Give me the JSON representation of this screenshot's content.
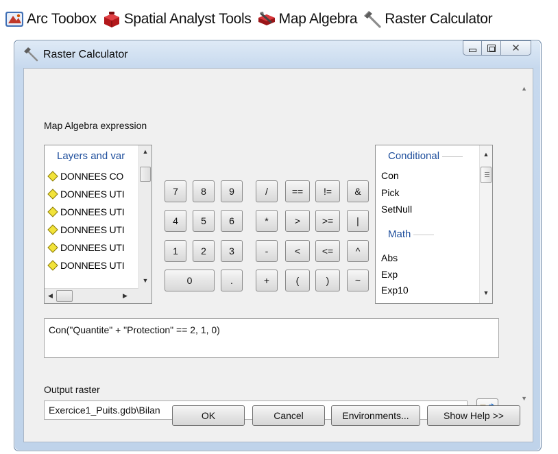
{
  "breadcrumb": [
    {
      "label": "Arc Toobox",
      "icon": "arc-toolbox-icon"
    },
    {
      "label": "Spatial Analyst Tools",
      "icon": "red-toolbox-icon"
    },
    {
      "label": "Map Algebra",
      "icon": "toolset-icon"
    },
    {
      "label": "Raster Calculator",
      "icon": "hammer-icon"
    }
  ],
  "window": {
    "title": "Raster Calculator",
    "controls": {
      "minimize": "minimize",
      "maximize": "maximize",
      "close": "close"
    }
  },
  "expression_label": "Map Algebra expression",
  "layers_panel": {
    "header": "Layers and var",
    "items": [
      "DONNEES CO",
      "DONNEES UTI",
      "DONNEES UTI",
      "DONNEES UTI",
      "DONNEES UTI",
      "DONNEES UTI"
    ]
  },
  "keypad": {
    "rows": [
      [
        "7",
        "8",
        "9",
        "/",
        "==",
        "!=",
        "&"
      ],
      [
        "4",
        "5",
        "6",
        "*",
        ">",
        ">=",
        "|"
      ],
      [
        "1",
        "2",
        "3",
        "-",
        "<",
        "<=",
        "^"
      ],
      [
        "0",
        ".",
        "+",
        "(",
        ")",
        "~"
      ]
    ]
  },
  "functions_panel": {
    "groups": [
      {
        "header": "Conditional",
        "items": [
          "Con",
          "Pick",
          "SetNull"
        ]
      },
      {
        "header": "Math",
        "items": [
          "Abs",
          "Exp",
          "Exp10"
        ]
      }
    ]
  },
  "expression": "Con(\"Quantite\" + \"Protection\" == 2, 1, 0)",
  "output_label": "Output raster",
  "output_value": "Exercice1_Puits.gdb\\Bilan",
  "buttons": {
    "ok": "OK",
    "cancel": "Cancel",
    "environments": "Environments...",
    "help": "Show Help >>"
  },
  "colors": {
    "accent_text": "#1e4e9c",
    "window_frame": "#c7d9ee",
    "layer_marker": "#f2e33a"
  }
}
